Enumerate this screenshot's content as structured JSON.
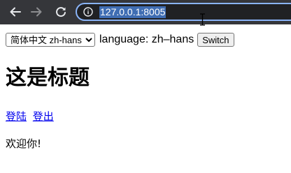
{
  "browser": {
    "url": "127.0.0.1:8005",
    "back_icon": "arrow-left-icon",
    "forward_icon": "arrow-right-icon",
    "reload_icon": "reload-icon",
    "info_icon": "info-icon",
    "toolbar_color": "#35363a",
    "omnibox_color": "#202124",
    "focus_color": "#8ab4f8",
    "selection_color": "#3f6db3"
  },
  "language_bar": {
    "select_value": "简体中文 zh-hans",
    "status_text": "language: zh–hans",
    "switch_label": "Switch"
  },
  "page": {
    "heading": "这是标题",
    "login_link": "登陆",
    "logout_link": "登出",
    "welcome": "欢迎你!",
    "link_color": "#0000ee"
  }
}
